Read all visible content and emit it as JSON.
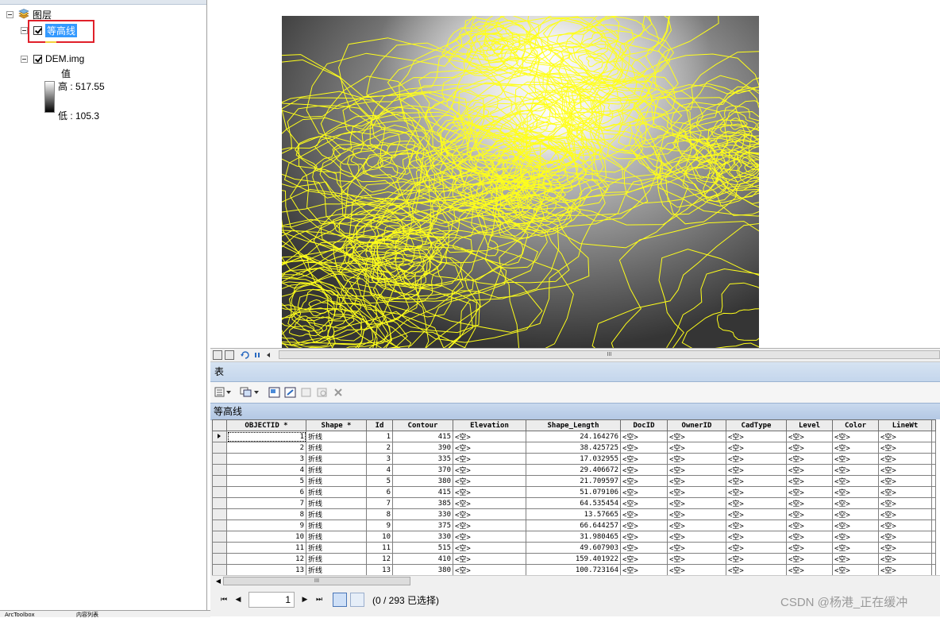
{
  "toc": {
    "root_label": "图层",
    "layers": [
      {
        "name": "等高线",
        "checked": true,
        "selected": true
      },
      {
        "name": "DEM.img",
        "checked": true,
        "selected": false
      }
    ],
    "legend": {
      "value_label": "值",
      "high": "高 : 517.55",
      "low": "低 : 105.3"
    }
  },
  "map": {
    "contour_color": "#ffff1a"
  },
  "table": {
    "window_title": "表",
    "tab_title": "等高线",
    "columns": [
      "OBJECTID *",
      "Shape *",
      "Id",
      "Contour",
      "Elevation",
      "Shape_Length",
      "DocID",
      "OwnerID",
      "CadType",
      "Level",
      "Color",
      "LineWt"
    ],
    "rows": [
      [
        "1",
        "折线",
        "1",
        "415",
        "<空>",
        "24.164276",
        "<空>",
        "<空>",
        "<空>",
        "<空>",
        "<空>",
        "<空>"
      ],
      [
        "2",
        "折线",
        "2",
        "390",
        "<空>",
        "38.425725",
        "<空>",
        "<空>",
        "<空>",
        "<空>",
        "<空>",
        "<空>"
      ],
      [
        "3",
        "折线",
        "3",
        "335",
        "<空>",
        "17.032955",
        "<空>",
        "<空>",
        "<空>",
        "<空>",
        "<空>",
        "<空>"
      ],
      [
        "4",
        "折线",
        "4",
        "370",
        "<空>",
        "29.406672",
        "<空>",
        "<空>",
        "<空>",
        "<空>",
        "<空>",
        "<空>"
      ],
      [
        "5",
        "折线",
        "5",
        "380",
        "<空>",
        "21.709597",
        "<空>",
        "<空>",
        "<空>",
        "<空>",
        "<空>",
        "<空>"
      ],
      [
        "6",
        "折线",
        "6",
        "415",
        "<空>",
        "51.079106",
        "<空>",
        "<空>",
        "<空>",
        "<空>",
        "<空>",
        "<空>"
      ],
      [
        "7",
        "折线",
        "7",
        "385",
        "<空>",
        "64.535454",
        "<空>",
        "<空>",
        "<空>",
        "<空>",
        "<空>",
        "<空>"
      ],
      [
        "8",
        "折线",
        "8",
        "330",
        "<空>",
        "13.57665",
        "<空>",
        "<空>",
        "<空>",
        "<空>",
        "<空>",
        "<空>"
      ],
      [
        "9",
        "折线",
        "9",
        "375",
        "<空>",
        "66.644257",
        "<空>",
        "<空>",
        "<空>",
        "<空>",
        "<空>",
        "<空>"
      ],
      [
        "10",
        "折线",
        "10",
        "330",
        "<空>",
        "31.980465",
        "<空>",
        "<空>",
        "<空>",
        "<空>",
        "<空>",
        "<空>"
      ],
      [
        "11",
        "折线",
        "11",
        "515",
        "<空>",
        "49.607903",
        "<空>",
        "<空>",
        "<空>",
        "<空>",
        "<空>",
        "<空>"
      ],
      [
        "12",
        "折线",
        "12",
        "410",
        "<空>",
        "159.401922",
        "<空>",
        "<空>",
        "<空>",
        "<空>",
        "<空>",
        "<空>"
      ],
      [
        "13",
        "折线",
        "13",
        "380",
        "<空>",
        "100.723164",
        "<空>",
        "<空>",
        "<空>",
        "<空>",
        "<空>",
        "<空>"
      ]
    ],
    "nav": {
      "record": "1",
      "status": "(0 / 293 已选择)"
    }
  },
  "bottom_tabs": [
    "ArcToolbox",
    "内容列表"
  ],
  "watermark": "CSDN @杨港_正在缓冲"
}
